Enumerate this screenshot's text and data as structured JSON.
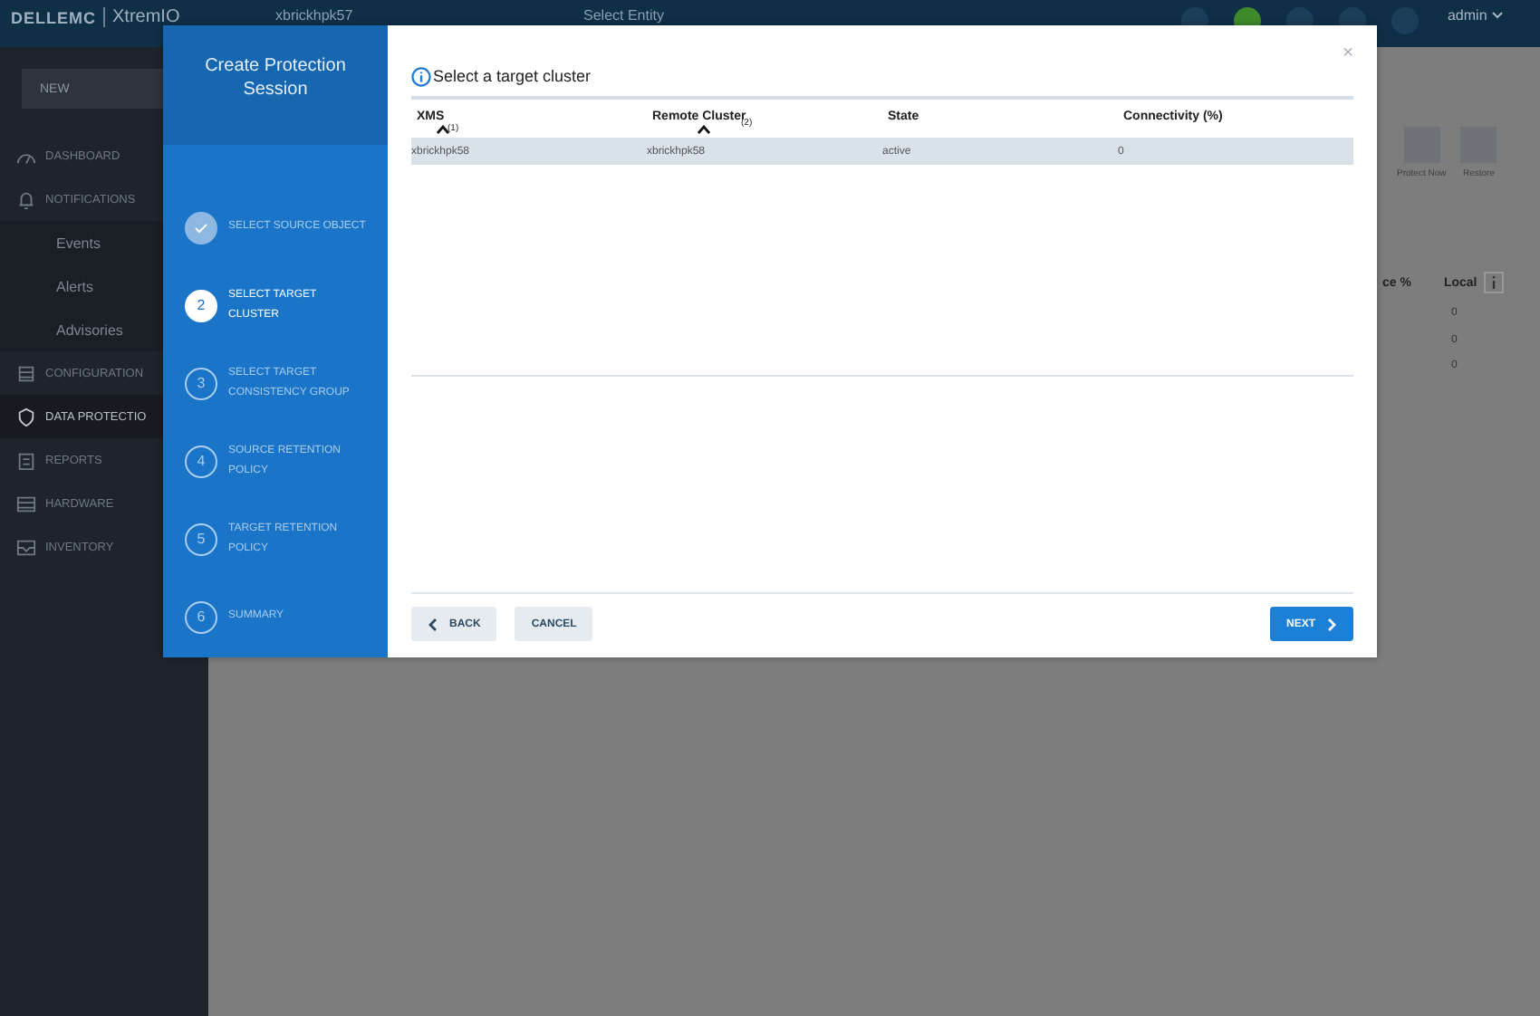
{
  "topbar": {
    "logo_brand": "DELLEMC",
    "logo_product": "XtremIO",
    "cluster": "xbrickhpk57",
    "entity": "Select Entity",
    "user": "admin"
  },
  "sidebar": {
    "new_button": "NEW",
    "items": [
      {
        "label": "DASHBOARD",
        "kind": "section",
        "selected": false
      },
      {
        "label": "NOTIFICATIONS",
        "kind": "section",
        "selected": false
      },
      {
        "label": "Events",
        "kind": "sub",
        "selected": false
      },
      {
        "label": "Alerts",
        "kind": "sub",
        "selected": false
      },
      {
        "label": "Advisories",
        "kind": "sub",
        "selected": false
      },
      {
        "label": "CONFIGURATION",
        "kind": "section",
        "selected": false
      },
      {
        "label": "DATA PROTECTIO",
        "kind": "section",
        "selected": true
      },
      {
        "label": "REPORTS",
        "kind": "section",
        "selected": false
      },
      {
        "label": "HARDWARE",
        "kind": "section",
        "selected": false
      },
      {
        "label": "INVENTORY",
        "kind": "section",
        "selected": false
      }
    ]
  },
  "background": {
    "actions": [
      "Protect Now",
      "Restore"
    ],
    "columns": [
      "ce %",
      "Local"
    ],
    "values": [
      "0",
      "0",
      "0"
    ]
  },
  "dialog": {
    "title": "Create Protection Session",
    "steps": [
      {
        "label": "SELECT SOURCE OBJECT",
        "completed": true,
        "selected": false
      },
      {
        "number": "2",
        "label": "SELECT TARGET CLUSTER",
        "completed": false,
        "selected": true
      },
      {
        "number": "3",
        "label": "SELECT TARGET CONSISTENCY GROUP",
        "completed": false,
        "selected": false
      },
      {
        "number": "4",
        "label": "SOURCE RETENTION POLICY",
        "completed": false,
        "selected": false
      },
      {
        "number": "5",
        "label": "TARGET RETENTION POLICY",
        "completed": false,
        "selected": false
      },
      {
        "number": "6",
        "label": "SUMMARY",
        "completed": false,
        "selected": false
      }
    ],
    "heading": "Select a target cluster",
    "close": "×",
    "table": {
      "columns": [
        {
          "label": "XMS",
          "sort_order": "(1)"
        },
        {
          "label": "Remote Cluster",
          "sort_order": "(2)"
        },
        {
          "label": "State"
        },
        {
          "label": "Connectivity (%)"
        }
      ],
      "rows": [
        {
          "cells": [
            "xbrickhpk58",
            "xbrickhpk58",
            "active",
            "0"
          ],
          "selected": true
        }
      ]
    },
    "buttons": {
      "back": "BACK",
      "cancel": "CANCEL",
      "next": "NEXT"
    }
  }
}
